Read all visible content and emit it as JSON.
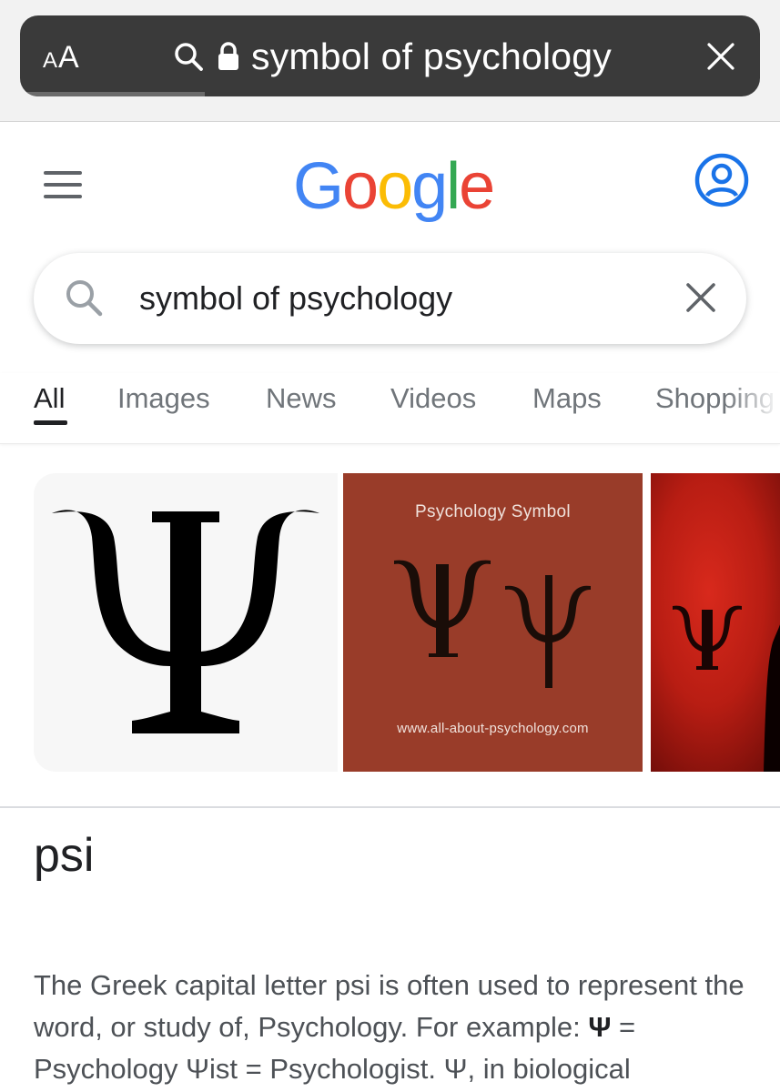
{
  "browser": {
    "text_size_label_small": "A",
    "text_size_label_large": "A",
    "address_text": "symbol of psychology",
    "load_progress": 0.25
  },
  "google": {
    "logo_letters": [
      "G",
      "o",
      "o",
      "g",
      "l",
      "e"
    ],
    "logo_colors": [
      "#4285F4",
      "#EA4335",
      "#FBBC05",
      "#4285F4",
      "#34A853",
      "#EA4335"
    ]
  },
  "search": {
    "query": "symbol of psychology"
  },
  "tabs": [
    {
      "label": "All",
      "active": true
    },
    {
      "label": "Images",
      "active": false
    },
    {
      "label": "News",
      "active": false
    },
    {
      "label": "Videos",
      "active": false
    },
    {
      "label": "Maps",
      "active": false
    },
    {
      "label": "Shopping",
      "active": false
    }
  ],
  "images": [
    {
      "glyph": "Ψ"
    },
    {
      "title": "Psychology Symbol",
      "glyphs": "ΨΨ",
      "url": "www.all-about-psychology.com"
    },
    {
      "glyph": "Ψ"
    }
  ],
  "result": {
    "title": "psi",
    "description_part1": "The Greek capital letter psi is often used to represent the word, or study of, Psychology. For example: ",
    "description_bold1": "Ψ",
    "description_part2": " = Psychology Ψist = Psychologist. Ψ, in biological"
  },
  "colors": {
    "accent_blue": "#1a73e8",
    "address_bar": "#3a3a3a",
    "image2_background": "#993c29"
  }
}
